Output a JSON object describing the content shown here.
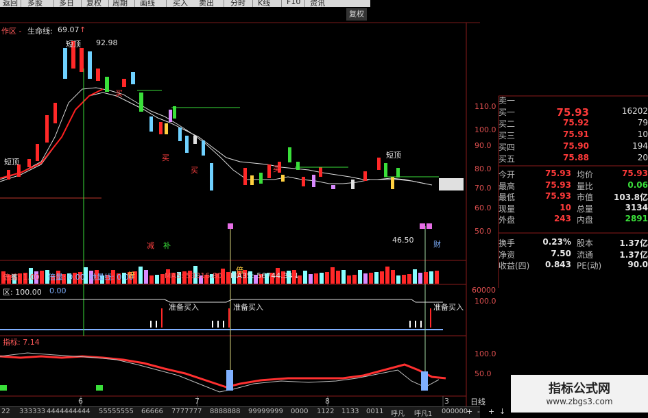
{
  "toolbar": {
    "items": [
      "返回",
      "多股",
      "多日",
      "复权",
      "周期",
      "画线",
      "买入",
      "卖出",
      "分时",
      "K线",
      "F10",
      "资讯"
    ],
    "right_button": "复权"
  },
  "kline_panel": {
    "title_prefix": "作区 -",
    "indicator_name": "生命线:",
    "indicator_value": "69.07",
    "indicator_arrow": "↑",
    "high_label": "短顶",
    "high_value": "92.98",
    "annotations": [
      "短顶",
      "短顶",
      "买",
      "买",
      "买",
      "买"
    ],
    "price_ticks": [
      "110.0",
      "100.0",
      "90.0",
      "80.0",
      "70.0",
      "60.0",
      "50.0"
    ]
  },
  "marker_panel": {
    "label_jian": "减",
    "label_bu": "补",
    "value_label": "46.50",
    "label_caibao": "财"
  },
  "volume_panel": {
    "multiplier_label": "倍缩: 1.00",
    "volume_label": "倍量: 0.00",
    "shrink_label": "地量线: 0.00",
    "ma5": "MA5: 53316.80",
    "ma35": "MA35: 56744.34",
    "ma35_arrow": "↓",
    "tick": "60000",
    "mark_bei": "倍"
  },
  "signal_panel": {
    "label": "区: 100.00",
    "label_extra": "0.00",
    "buy_labels": [
      "准备买入",
      "准备买入",
      "准备买入"
    ],
    "tick": "100.0"
  },
  "osc_panel": {
    "label": "指标: 7.14",
    "ticks": [
      "100.0",
      "50.0"
    ]
  },
  "quote": {
    "sell1_label": "卖一",
    "buy_rows": [
      {
        "label": "买一",
        "price": "75.93",
        "vol": "16202"
      },
      {
        "label": "买二",
        "price": "75.92",
        "vol": "79"
      },
      {
        "label": "买三",
        "price": "75.91",
        "vol": "10"
      },
      {
        "label": "买四",
        "price": "75.90",
        "vol": "194"
      },
      {
        "label": "买五",
        "price": "75.88",
        "vol": "20"
      }
    ],
    "stats": [
      {
        "l1": "今开",
        "v1": "75.93",
        "l2": "均价",
        "v2": "75.93"
      },
      {
        "l1": "最高",
        "v1": "75.93",
        "l2": "量比",
        "v2": "0.06"
      },
      {
        "l1": "最低",
        "v1": "75.93",
        "l2": "市值",
        "v2": "103.8亿"
      },
      {
        "l1": "现量",
        "v1": "10",
        "l2": "总量",
        "v2": "3134"
      },
      {
        "l1": "外盘",
        "v1": "243",
        "l2": "内盘",
        "v2": "2891"
      }
    ],
    "stats2": [
      {
        "l1": "换手",
        "v1": "0.23%",
        "l2": "股本",
        "v2": "1.37亿"
      },
      {
        "l1": "净资",
        "v1": "7.50",
        "l2": "流通",
        "v2": "1.37亿"
      },
      {
        "l1": "收益(四)",
        "v1": "0.843",
        "l2": "PE(动)",
        "v2": "90.0"
      }
    ],
    "colors": {
      "up": "#ff3a3a",
      "green": "#3adf3a",
      "neutral": "#e6e6e6"
    }
  },
  "x_axis": {
    "labels": [
      "6",
      "7",
      "8",
      "3"
    ]
  },
  "bottom_tabs": [
    "22",
    "333333",
    "4444444444",
    "55555555",
    "66666",
    "7777777",
    "8888888",
    "99999999",
    "0000",
    "1122",
    "1133",
    "0011",
    "呼凡",
    "呼凡1",
    "000000"
  ],
  "bottom_right": {
    "period": "日线",
    "buttons": [
      "+",
      "-",
      "+",
      "↓"
    ]
  },
  "watermark": {
    "title": "指标公式网",
    "url": "www.zbgs3.com"
  }
}
